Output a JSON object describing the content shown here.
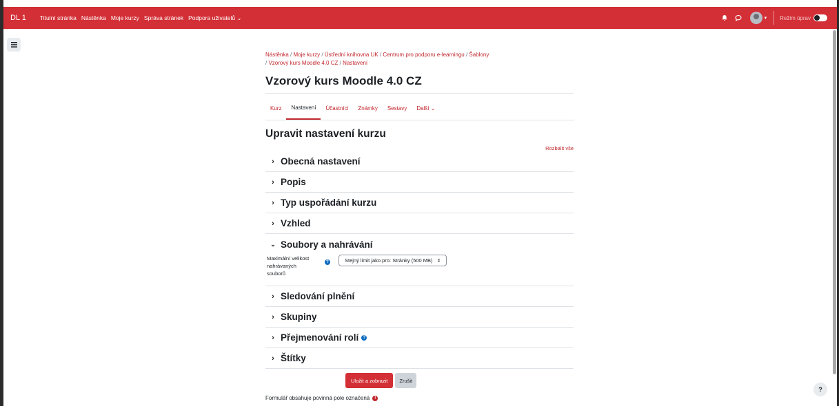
{
  "navbar": {
    "brand": "DL 1",
    "links": [
      "Titulní stránka",
      "Nástěnka",
      "Moje kurzy",
      "Správa stránek",
      "Podpora uživatelů ⌄"
    ],
    "edit_mode_label": "Režim úprav"
  },
  "breadcrumb": {
    "items": [
      "Nástěnka",
      "Moje kurzy",
      "Ústřední knihovna UK",
      "Centrum pro podporu e-learningu",
      "Šablony",
      "Vzorový kurs Moodle 4.0 CZ",
      "Nastavení"
    ],
    "separator": "/"
  },
  "course": {
    "title": "Vzorový kurs Moodle 4.0 CZ"
  },
  "tabs": [
    "Kurz",
    "Nastavení",
    "Účastníci",
    "Známky",
    "Sestavy",
    "Další ⌄"
  ],
  "page_heading": "Upravit nastavení kurzu",
  "expand_all": "Rozbalit vše",
  "sections": {
    "general": "Obecná nastavení",
    "description": "Popis",
    "format": "Typ uspořádání kurzu",
    "appearance": "Vzhled",
    "files": "Soubory a nahrávání",
    "completion": "Sledování plnění",
    "groups": "Skupiny",
    "roles": "Přejmenování rolí",
    "tags": "Štítky"
  },
  "files_field": {
    "label_line1": "Maximální velikost",
    "label_line2": "nahrávaných",
    "label_line3": "souborů",
    "value": "Stejný limit jako pro: Stránky (500 MB)"
  },
  "buttons": {
    "save": "Uložit a zobrazit",
    "cancel": "Zrušit"
  },
  "required_note": "Formulář obsahuje povinná pole označená",
  "colors": {
    "brand": "#d32f36",
    "link": "#c1272d",
    "help": "#0f6cbf"
  }
}
